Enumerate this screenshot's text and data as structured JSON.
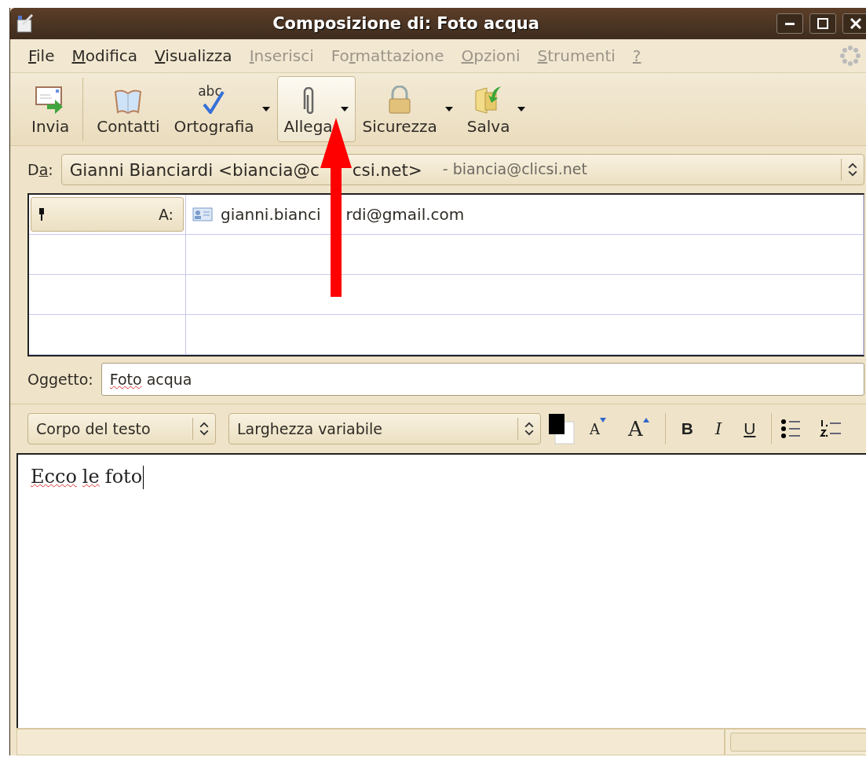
{
  "window": {
    "title": "Composizione di: Foto acqua"
  },
  "menu": [
    {
      "key": "F",
      "after": "ile",
      "disabled": false
    },
    {
      "key": "M",
      "after": "odifica",
      "disabled": false
    },
    {
      "key": "V",
      "after": "isualizza",
      "disabled": false
    },
    {
      "key": "I",
      "after": "nserisci",
      "disabled": true
    },
    {
      "before": "Fo",
      "key": "r",
      "after": "mattazione",
      "disabled": true
    },
    {
      "key": "O",
      "after": "pzioni",
      "disabled": true
    },
    {
      "key": "S",
      "after": "trumenti",
      "disabled": true
    },
    {
      "key": "?",
      "disabled": true
    }
  ],
  "toolbar": [
    {
      "label": "Invia",
      "dropdown": false,
      "selected": false
    },
    {
      "label": "Contatti",
      "dropdown": false,
      "selected": false
    },
    {
      "label": "Ortografia",
      "icon_text": "abc",
      "dropdown": true,
      "selected": false
    },
    {
      "label": "Allega",
      "dropdown": true,
      "selected": true
    },
    {
      "label": "Sicurezza",
      "dropdown": true,
      "selected": false
    },
    {
      "label": "Salva",
      "dropdown": true,
      "selected": false
    }
  ],
  "from": {
    "label_before": "D",
    "label_key": "a",
    "label_after": ":",
    "value_parts": [
      "Gianni Bianciardi <biancia@c",
      "csi.net>"
    ],
    "account": "- biancia@clicsi.net"
  },
  "recipients": [
    {
      "type": "A:",
      "address_parts": [
        "gianni.bianci",
        "rdi@gmail.com"
      ]
    }
  ],
  "subject": {
    "label": "Oggetto:",
    "words": [
      {
        "text": "Foto",
        "misspelled": true
      },
      {
        "text": "acqua",
        "misspelled": false
      }
    ]
  },
  "format": {
    "paragraph": "Corpo del testo",
    "font": "Larghezza variabile",
    "size_buttons": [
      {
        "kind": "smaller",
        "label": "A"
      },
      {
        "kind": "larger",
        "label": "A"
      }
    ],
    "style_buttons": [
      {
        "kind": "bold",
        "label": "B"
      },
      {
        "kind": "italic",
        "label": "I"
      },
      {
        "kind": "underline",
        "label": "U"
      }
    ]
  },
  "body": {
    "words": [
      {
        "text": "Ecco",
        "misspelled": true
      },
      {
        "text": "le",
        "misspelled": true
      },
      {
        "text": "foto",
        "misspelled": false
      }
    ]
  }
}
